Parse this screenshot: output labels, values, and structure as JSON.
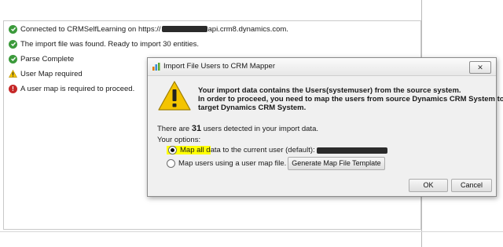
{
  "log": {
    "connected_prefix": "Connected to CRMSelfLearning on https://",
    "connected_suffix": "api.crm8.dynamics.com.",
    "import_found": "The import file was found. Ready to import 30 entities.",
    "parse_complete": "Parse Complete",
    "user_map_required": "User Map required",
    "user_map_error": "A user map is required to proceed."
  },
  "dialog": {
    "title": "Import File Users to CRM Mapper",
    "close_label": "✕",
    "message_line1": "Your import data contains the Users(systemuser) from the source system.",
    "message_line2": "In order to proceed, you need to map the users from source Dynamics CRM System to the",
    "message_line3": "target Dynamics CRM System.",
    "count_prefix": "There are ",
    "count_value": "31",
    "count_suffix": " users detected in your import data.",
    "options_label": "Your options:",
    "option1_highlight": "Map all d",
    "option1_rest": "ata to the current user (default): ",
    "option2_label": "Map users using a user map file.",
    "generate_button": "Generate Map File Template",
    "ok_button": "OK",
    "cancel_button": "Cancel"
  },
  "colors": {
    "success": "#3b9a3b",
    "warning": "#f2c200",
    "error": "#c62828",
    "highlight": "#ffff00"
  }
}
